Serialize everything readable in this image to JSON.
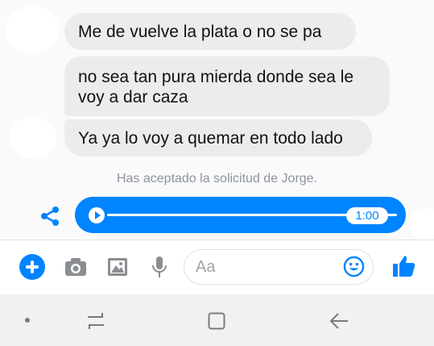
{
  "messages": [
    {
      "text": "Me  de  vuelve la plata o no se pa"
    },
    {
      "text": "no sea tan pura mierda donde sea le voy a dar caza"
    },
    {
      "text": "Ya ya lo voy a quemar en todo lado"
    }
  ],
  "system_notice": "Has aceptado la solicitud de Jorge.",
  "audio": {
    "duration": "1:00",
    "progress": 1.0
  },
  "composer": {
    "placeholder": "Aa"
  },
  "colors": {
    "accent": "#0084ff",
    "bubble": "#ececec",
    "muted": "#8d949e"
  },
  "icons": [
    "share-icon",
    "play-icon",
    "add-icon",
    "camera-icon",
    "image-icon",
    "microphone-icon",
    "emoji-icon",
    "like-icon",
    "nav-dot-icon",
    "recents-icon",
    "home-icon",
    "back-icon"
  ]
}
